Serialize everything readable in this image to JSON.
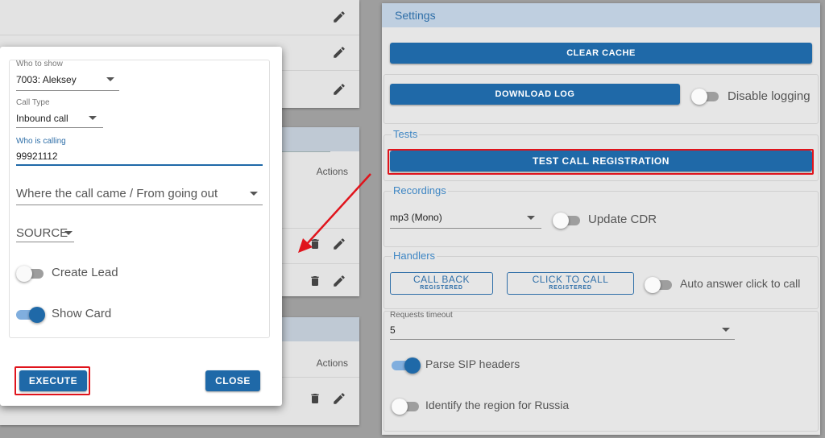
{
  "background": {
    "actions_label": "Actions"
  },
  "settings": {
    "title": "Settings",
    "clear_cache_label": "CLEAR CACHE",
    "download_log_label": "DOWNLOAD LOG",
    "disable_logging_label": "Disable logging",
    "disable_logging_on": false,
    "tests": {
      "legend": "Tests",
      "test_call_registration_label": "TEST CALL REGISTRATION"
    },
    "recordings": {
      "legend": "Recordings",
      "format_value": "mp3 (Mono)",
      "update_cdr_label": "Update CDR",
      "update_cdr_on": false
    },
    "handlers": {
      "legend": "Handlers",
      "call_back_label": "CALL BACK",
      "call_back_status": "REGISTERED",
      "click_to_call_label": "CLICK TO CALL",
      "click_to_call_status": "REGISTERED",
      "auto_answer_label": "Auto answer click to call",
      "auto_answer_on": false
    },
    "requests_timeout": {
      "label": "Requests timeout",
      "value": "5"
    },
    "parse_sip_label": "Parse SIP headers",
    "parse_sip_on": true,
    "identify_region_label": "Identify the region for Russia",
    "identify_region_on": false
  },
  "dialog": {
    "who_to_show_label": "Who to show",
    "who_to_show_value": "7003: Aleksey",
    "call_type_label": "Call Type",
    "call_type_value": "Inbound call",
    "who_is_calling_label": "Who is calling",
    "who_is_calling_value": "99921112",
    "direction_placeholder": "Where the call came / From going out",
    "source_placeholder": "SOURCE",
    "create_lead_label": "Create Lead",
    "create_lead_on": false,
    "show_card_label": "Show Card",
    "show_card_on": true,
    "execute_label": "EXECUTE",
    "close_label": "CLOSE"
  },
  "colors": {
    "primary": "#1f69a8",
    "highlight": "#e0141c",
    "arrow": "#e0141c"
  }
}
